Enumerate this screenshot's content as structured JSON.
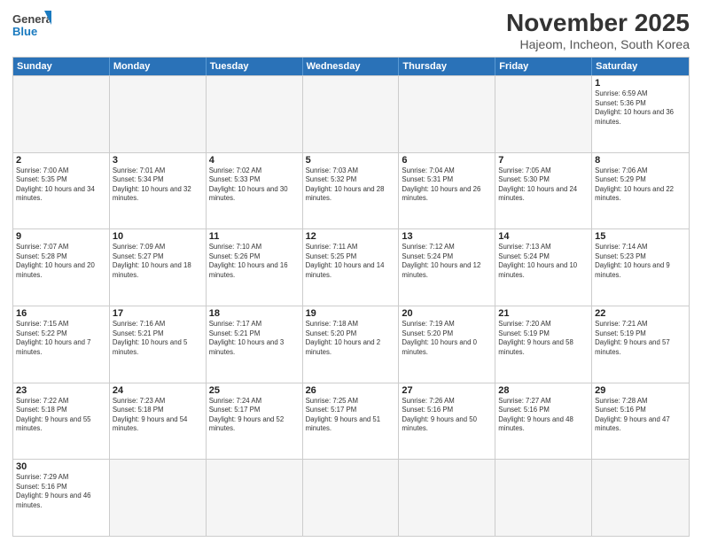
{
  "header": {
    "logo_general": "General",
    "logo_blue": "Blue",
    "title": "November 2025",
    "subtitle": "Hajeom, Incheon, South Korea"
  },
  "weekdays": [
    "Sunday",
    "Monday",
    "Tuesday",
    "Wednesday",
    "Thursday",
    "Friday",
    "Saturday"
  ],
  "weeks": [
    [
      {
        "day": "",
        "info": ""
      },
      {
        "day": "",
        "info": ""
      },
      {
        "day": "",
        "info": ""
      },
      {
        "day": "",
        "info": ""
      },
      {
        "day": "",
        "info": ""
      },
      {
        "day": "",
        "info": ""
      },
      {
        "day": "1",
        "info": "Sunrise: 6:59 AM\nSunset: 5:36 PM\nDaylight: 10 hours and 36 minutes."
      }
    ],
    [
      {
        "day": "2",
        "info": "Sunrise: 7:00 AM\nSunset: 5:35 PM\nDaylight: 10 hours and 34 minutes."
      },
      {
        "day": "3",
        "info": "Sunrise: 7:01 AM\nSunset: 5:34 PM\nDaylight: 10 hours and 32 minutes."
      },
      {
        "day": "4",
        "info": "Sunrise: 7:02 AM\nSunset: 5:33 PM\nDaylight: 10 hours and 30 minutes."
      },
      {
        "day": "5",
        "info": "Sunrise: 7:03 AM\nSunset: 5:32 PM\nDaylight: 10 hours and 28 minutes."
      },
      {
        "day": "6",
        "info": "Sunrise: 7:04 AM\nSunset: 5:31 PM\nDaylight: 10 hours and 26 minutes."
      },
      {
        "day": "7",
        "info": "Sunrise: 7:05 AM\nSunset: 5:30 PM\nDaylight: 10 hours and 24 minutes."
      },
      {
        "day": "8",
        "info": "Sunrise: 7:06 AM\nSunset: 5:29 PM\nDaylight: 10 hours and 22 minutes."
      }
    ],
    [
      {
        "day": "9",
        "info": "Sunrise: 7:07 AM\nSunset: 5:28 PM\nDaylight: 10 hours and 20 minutes."
      },
      {
        "day": "10",
        "info": "Sunrise: 7:09 AM\nSunset: 5:27 PM\nDaylight: 10 hours and 18 minutes."
      },
      {
        "day": "11",
        "info": "Sunrise: 7:10 AM\nSunset: 5:26 PM\nDaylight: 10 hours and 16 minutes."
      },
      {
        "day": "12",
        "info": "Sunrise: 7:11 AM\nSunset: 5:25 PM\nDaylight: 10 hours and 14 minutes."
      },
      {
        "day": "13",
        "info": "Sunrise: 7:12 AM\nSunset: 5:24 PM\nDaylight: 10 hours and 12 minutes."
      },
      {
        "day": "14",
        "info": "Sunrise: 7:13 AM\nSunset: 5:24 PM\nDaylight: 10 hours and 10 minutes."
      },
      {
        "day": "15",
        "info": "Sunrise: 7:14 AM\nSunset: 5:23 PM\nDaylight: 10 hours and 9 minutes."
      }
    ],
    [
      {
        "day": "16",
        "info": "Sunrise: 7:15 AM\nSunset: 5:22 PM\nDaylight: 10 hours and 7 minutes."
      },
      {
        "day": "17",
        "info": "Sunrise: 7:16 AM\nSunset: 5:21 PM\nDaylight: 10 hours and 5 minutes."
      },
      {
        "day": "18",
        "info": "Sunrise: 7:17 AM\nSunset: 5:21 PM\nDaylight: 10 hours and 3 minutes."
      },
      {
        "day": "19",
        "info": "Sunrise: 7:18 AM\nSunset: 5:20 PM\nDaylight: 10 hours and 2 minutes."
      },
      {
        "day": "20",
        "info": "Sunrise: 7:19 AM\nSunset: 5:20 PM\nDaylight: 10 hours and 0 minutes."
      },
      {
        "day": "21",
        "info": "Sunrise: 7:20 AM\nSunset: 5:19 PM\nDaylight: 9 hours and 58 minutes."
      },
      {
        "day": "22",
        "info": "Sunrise: 7:21 AM\nSunset: 5:19 PM\nDaylight: 9 hours and 57 minutes."
      }
    ],
    [
      {
        "day": "23",
        "info": "Sunrise: 7:22 AM\nSunset: 5:18 PM\nDaylight: 9 hours and 55 minutes."
      },
      {
        "day": "24",
        "info": "Sunrise: 7:23 AM\nSunset: 5:18 PM\nDaylight: 9 hours and 54 minutes."
      },
      {
        "day": "25",
        "info": "Sunrise: 7:24 AM\nSunset: 5:17 PM\nDaylight: 9 hours and 52 minutes."
      },
      {
        "day": "26",
        "info": "Sunrise: 7:25 AM\nSunset: 5:17 PM\nDaylight: 9 hours and 51 minutes."
      },
      {
        "day": "27",
        "info": "Sunrise: 7:26 AM\nSunset: 5:16 PM\nDaylight: 9 hours and 50 minutes."
      },
      {
        "day": "28",
        "info": "Sunrise: 7:27 AM\nSunset: 5:16 PM\nDaylight: 9 hours and 48 minutes."
      },
      {
        "day": "29",
        "info": "Sunrise: 7:28 AM\nSunset: 5:16 PM\nDaylight: 9 hours and 47 minutes."
      }
    ],
    [
      {
        "day": "30",
        "info": "Sunrise: 7:29 AM\nSunset: 5:16 PM\nDaylight: 9 hours and 46 minutes."
      },
      {
        "day": "",
        "info": ""
      },
      {
        "day": "",
        "info": ""
      },
      {
        "day": "",
        "info": ""
      },
      {
        "day": "",
        "info": ""
      },
      {
        "day": "",
        "info": ""
      },
      {
        "day": "",
        "info": ""
      }
    ]
  ]
}
